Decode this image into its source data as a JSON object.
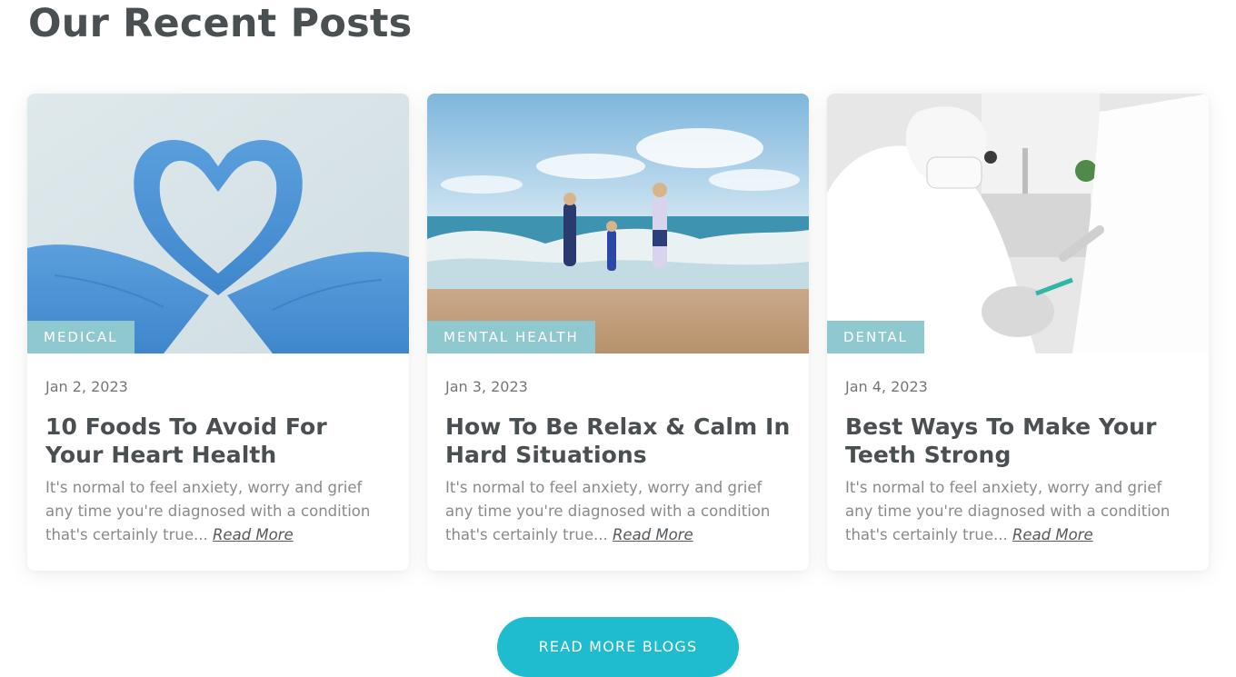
{
  "section": {
    "title": "Our Recent Posts"
  },
  "posts": [
    {
      "category": "MEDICAL",
      "date": "Jan 2, 2023",
      "title": "10 Foods To Avoid For Your Heart Health",
      "excerpt": "It's normal to feel anxiety, worry and grief any time you're diagnosed with a condition that's certainly true...",
      "read_more": "Read More"
    },
    {
      "category": "MENTAL HEALTH",
      "date": "Jan 3, 2023",
      "title": "How To Be Relax & Calm In Hard Situations",
      "excerpt": "It's normal to feel anxiety, worry and grief any time you're diagnosed with a condition that's certainly true...",
      "read_more": "Read More"
    },
    {
      "category": "DENTAL",
      "date": "Jan 4, 2023",
      "title": "Best Ways To Make Your Teeth Strong",
      "excerpt": "It's normal to feel anxiety, worry and grief any time you're diagnosed with a condition that's certainly true...",
      "read_more": "Read More"
    }
  ],
  "cta": {
    "label": "READ MORE BLOGS"
  },
  "colors": {
    "accent": "#1fbccf",
    "tag": "#8fc9cf",
    "heading": "#4a4f52",
    "body_text": "#8a8a8a"
  }
}
